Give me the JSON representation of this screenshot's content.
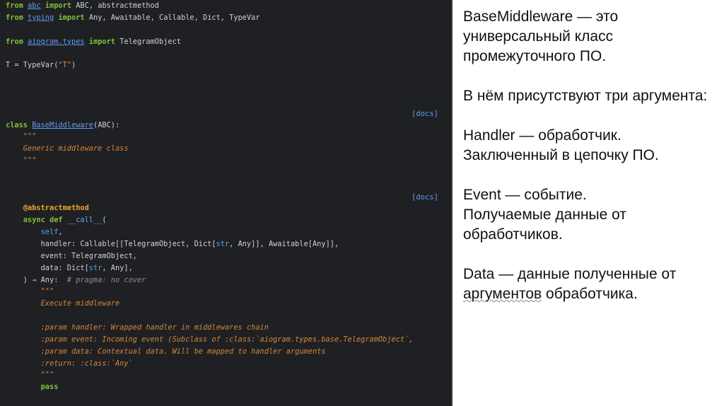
{
  "code": {
    "docs_label": "[docs]",
    "lines": [
      {
        "row": 0,
        "tokens": [
          [
            "from ",
            "kw"
          ],
          [
            "abc",
            "mod"
          ],
          [
            " import ",
            "kw"
          ],
          [
            "ABC, abstractmethod",
            ""
          ]
        ]
      },
      {
        "row": 1,
        "tokens": [
          [
            "from ",
            "kw"
          ],
          [
            "typing",
            "mod"
          ],
          [
            " import ",
            "kw"
          ],
          [
            "Any, Awaitable, Callable, Dict, TypeVar",
            ""
          ]
        ]
      },
      {
        "row": 3,
        "tokens": [
          [
            "from ",
            "kw"
          ],
          [
            "aiogram.types",
            "mod"
          ],
          [
            " import ",
            "kw"
          ],
          [
            "TelegramObject",
            ""
          ]
        ]
      },
      {
        "row": 5,
        "tokens": [
          [
            "T = TypeVar(",
            ""
          ],
          [
            "\"T\"",
            "str"
          ],
          [
            ")",
            ""
          ]
        ]
      },
      {
        "row": 10,
        "tokens": [
          [
            "class ",
            "kw"
          ],
          [
            "BaseMiddleware",
            "mod"
          ],
          [
            "(ABC):",
            ""
          ]
        ]
      },
      {
        "row": 11,
        "tokens": [
          [
            "    \"\"\"",
            "doc"
          ]
        ]
      },
      {
        "row": 12,
        "tokens": [
          [
            "    Generic middleware class",
            "doc"
          ]
        ]
      },
      {
        "row": 13,
        "tokens": [
          [
            "    \"\"\"",
            "doc"
          ]
        ]
      },
      {
        "row": 17,
        "tokens": [
          [
            "    ",
            ""
          ],
          [
            "@abstractmethod",
            "dec"
          ]
        ]
      },
      {
        "row": 18,
        "tokens": [
          [
            "    ",
            ""
          ],
          [
            "async def ",
            "kw"
          ],
          [
            "__call__",
            "fn"
          ],
          [
            "(",
            ""
          ]
        ]
      },
      {
        "row": 19,
        "tokens": [
          [
            "        ",
            ""
          ],
          [
            "self",
            "self"
          ],
          [
            ",",
            ""
          ]
        ]
      },
      {
        "row": 20,
        "tokens": [
          [
            "        handler: Callable[[TelegramObject, Dict[",
            ""
          ],
          [
            "str",
            "bi"
          ],
          [
            ", Any]], Awaitable[Any]],",
            ""
          ]
        ]
      },
      {
        "row": 21,
        "tokens": [
          [
            "        event: TelegramObject,",
            ""
          ]
        ]
      },
      {
        "row": 22,
        "tokens": [
          [
            "        data: Dict[",
            ""
          ],
          [
            "str",
            "bi"
          ],
          [
            ", Any],",
            ""
          ]
        ]
      },
      {
        "row": 23,
        "tokens": [
          [
            "    ) → Any:  ",
            ""
          ],
          [
            "# pragma: no cover",
            "cmt"
          ]
        ]
      },
      {
        "row": 24,
        "tokens": [
          [
            "        \"\"\"",
            "doc"
          ]
        ]
      },
      {
        "row": 25,
        "tokens": [
          [
            "        Execute middleware",
            "doc"
          ]
        ]
      },
      {
        "row": 27,
        "tokens": [
          [
            "        :param handler: Wrapped handler in middlewares chain",
            "doc"
          ]
        ]
      },
      {
        "row": 28,
        "tokens": [
          [
            "        :param event: Incoming event (Subclass of :class:`aiogram.types.base.TelegramObject`,",
            "doc"
          ]
        ]
      },
      {
        "row": 29,
        "tokens": [
          [
            "        :param data: Contextual data. Will be mapped to handler arguments",
            "doc"
          ]
        ]
      },
      {
        "row": 30,
        "tokens": [
          [
            "        :return: :class:`Any`",
            "doc"
          ]
        ]
      },
      {
        "row": 31,
        "tokens": [
          [
            "        \"\"\"",
            "doc"
          ]
        ]
      },
      {
        "row": 32,
        "tokens": [
          [
            "        ",
            ""
          ],
          [
            "pass",
            "kw"
          ]
        ]
      }
    ],
    "docs_rows": [
      9,
      16
    ]
  },
  "slide": {
    "p1": "BaseMiddleware — это универсальный класс промежуточного ПО.",
    "p2": "В нём присутствуют три аргумента:",
    "p3a": "Handler — обработчик.",
    "p3b": "Заключенный в цепочку ПО.",
    "p4a": "Event — событие.",
    "p4b": "Получаемые данные от обработчиков.",
    "p5a": "Data — данные полученные от ",
    "p5b": "аргументов",
    "p5c": " обработчика."
  }
}
